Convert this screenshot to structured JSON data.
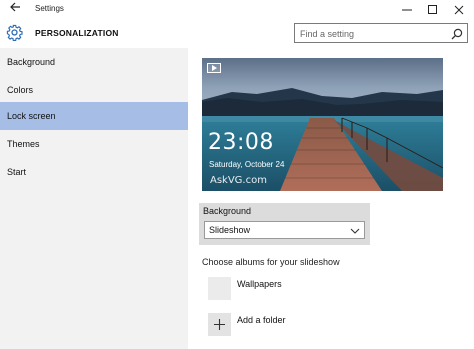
{
  "window": {
    "title": "Settings",
    "back_icon": "back-arrow-icon",
    "controls": [
      "minimize-icon",
      "maximize-icon",
      "close-icon"
    ]
  },
  "header": {
    "icon": "gear-icon",
    "title": "PERSONALIZATION",
    "search": {
      "placeholder": "Find a setting",
      "value": "",
      "icon": "search-icon"
    }
  },
  "sidebar": {
    "items": [
      {
        "label": "Background",
        "active": false
      },
      {
        "label": "Colors",
        "active": false
      },
      {
        "label": "Lock screen",
        "active": true
      },
      {
        "label": "Themes",
        "active": false
      },
      {
        "label": "Start",
        "active": false
      }
    ]
  },
  "main": {
    "preview": {
      "time": "23:08",
      "date": "Saturday, October 24",
      "watermark": "AskVG.com",
      "slideshow_badge_icon": "slideshow-icon"
    },
    "background": {
      "label": "Background",
      "selected": "Slideshow",
      "options": [
        "Slideshow"
      ]
    },
    "albums": {
      "label": "Choose albums for your slideshow",
      "items": [
        {
          "name": "Wallpapers"
        },
        {
          "name": "Add a folder",
          "icon": "plus-icon"
        }
      ]
    }
  },
  "colors": {
    "sidebar_bg": "#f2f2f2",
    "active_item": "#a6bde6",
    "accent": "#2b6ab5"
  }
}
